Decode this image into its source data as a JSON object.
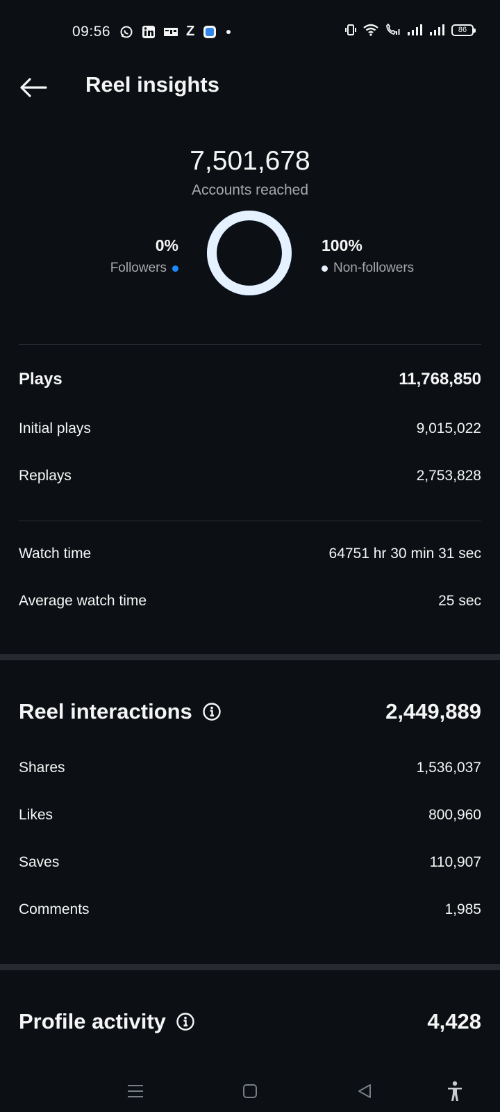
{
  "status_bar": {
    "time": "09:56",
    "left_icons": [
      "whatsapp-icon",
      "linkedin-icon",
      "app-icon",
      "z-app-icon",
      "blue-app-icon",
      "dot-icon"
    ],
    "right_icons": [
      "vibrate-icon",
      "wifi-icon",
      "wifi-calling-icon",
      "signal-icon",
      "signal-icon"
    ],
    "battery": "86",
    "z_glyph": "Z"
  },
  "header": {
    "title": "Reel insights"
  },
  "reach": {
    "count": "7,501,678",
    "label": "Accounts reached",
    "followers_pct": "0%",
    "followers_label": "Followers",
    "non_followers_pct": "100%",
    "non_followers_label": "Non-followers",
    "followers_fraction": 0.0,
    "non_followers_fraction": 1.0,
    "followers_color": "#1a8cff",
    "non_followers_color": "#e6f1ff"
  },
  "plays": {
    "label": "Plays",
    "value": "11,768,850",
    "rows": [
      {
        "label": "Initial plays",
        "value": "9,015,022"
      },
      {
        "label": "Replays",
        "value": "2,753,828"
      }
    ]
  },
  "watch": {
    "rows": [
      {
        "label": "Watch time",
        "value": "64751 hr 30 min 31 sec"
      },
      {
        "label": "Average watch time",
        "value": "25 sec"
      }
    ]
  },
  "interactions": {
    "label": "Reel interactions",
    "value": "2,449,889",
    "info_icon": "info-icon",
    "rows": [
      {
        "label": "Shares",
        "value": "1,536,037"
      },
      {
        "label": "Likes",
        "value": "800,960"
      },
      {
        "label": "Saves",
        "value": "110,907"
      },
      {
        "label": "Comments",
        "value": "1,985"
      }
    ]
  },
  "profile_activity": {
    "label": "Profile activity",
    "value": "4,428",
    "info_icon": "info-icon"
  },
  "nav_bar": {
    "buttons": [
      "menu-icon",
      "home-square-icon",
      "back-triangle-icon",
      "accessibility-icon"
    ]
  },
  "colors": {
    "background": "#0c1014",
    "text": "#f5f5f5",
    "secondary_text": "#a8a8ad",
    "accent_blue": "#1a8cff"
  }
}
